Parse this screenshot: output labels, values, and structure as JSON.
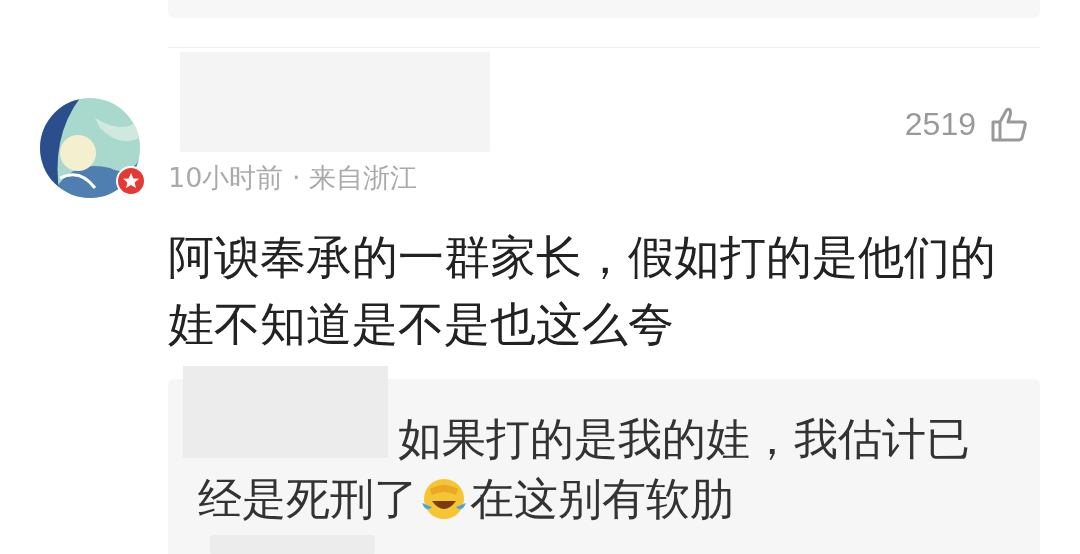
{
  "comment": {
    "meta": "10小时前 · 来自浙江",
    "likes": "2519",
    "text": "阿谀奉承的一群家长，假如打的是他们的娃不知道是不是也这么夸",
    "reply": {
      "line_1": "如果打的是我的娃，我估计已",
      "line_2_before": "经是死刑了",
      "line_2_after": "在这别有软肋"
    }
  }
}
